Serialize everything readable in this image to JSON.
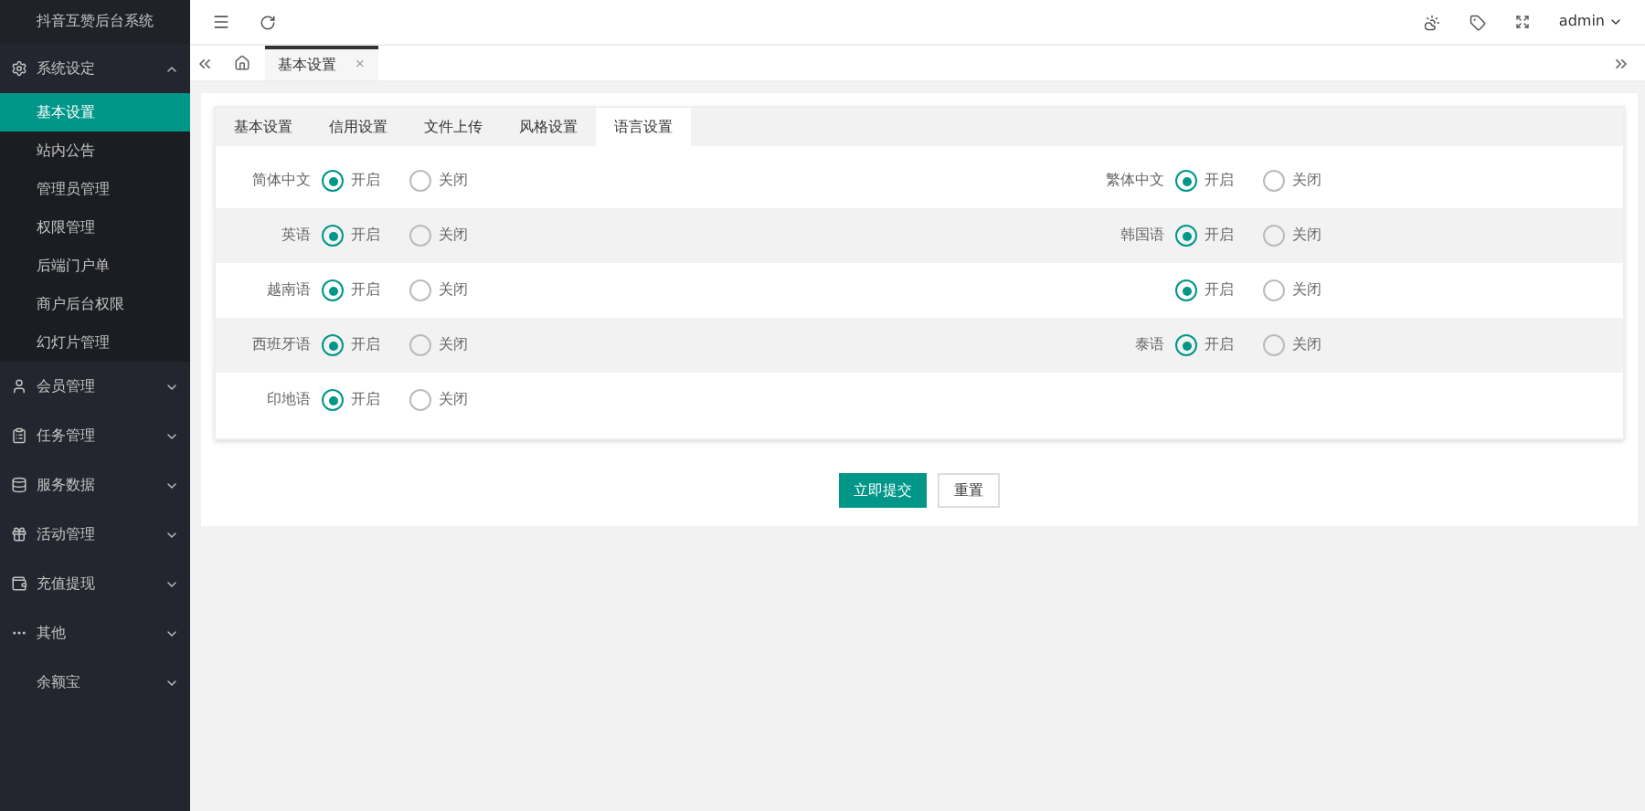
{
  "sidebar": {
    "title": "抖音互赞后台系统",
    "groups": [
      {
        "label": "系统设定",
        "expanded": true,
        "children": [
          {
            "label": "基本设置",
            "selected": true
          },
          {
            "label": "站内公告",
            "selected": false
          },
          {
            "label": "管理员管理",
            "selected": false
          },
          {
            "label": "权限管理",
            "selected": false
          },
          {
            "label": "后端门户单",
            "selected": false
          },
          {
            "label": "商户后台权限",
            "selected": false
          },
          {
            "label": "幻灯片管理",
            "selected": false
          }
        ]
      },
      {
        "label": "会员管理",
        "expanded": false
      },
      {
        "label": "任务管理",
        "expanded": false
      },
      {
        "label": "服务数据",
        "expanded": false
      },
      {
        "label": "活动管理",
        "expanded": false
      },
      {
        "label": "充值提现",
        "expanded": false
      },
      {
        "label": "其他",
        "expanded": false
      },
      {
        "label": "余额宝",
        "expanded": false
      }
    ]
  },
  "topbar": {
    "user": "admin"
  },
  "page_tabs": [
    {
      "label": "基本设置",
      "selected": true,
      "close": "×"
    }
  ],
  "settings_tabs": [
    {
      "label": "基本设置",
      "selected": false
    },
    {
      "label": "信用设置",
      "selected": false
    },
    {
      "label": "文件上传",
      "selected": false
    },
    {
      "label": "风格设置",
      "selected": false
    },
    {
      "label": "语言设置",
      "selected": true
    }
  ],
  "rows": [
    [
      {
        "label": "简体中文",
        "options": [
          {
            "label": "开启",
            "selected": true
          },
          {
            "label": "关闭",
            "selected": false
          }
        ]
      },
      {
        "label": "繁体中文",
        "options": [
          {
            "label": "开启",
            "selected": true
          },
          {
            "label": "关闭",
            "selected": false
          }
        ]
      }
    ],
    [
      {
        "label": "英语",
        "options": [
          {
            "label": "开启",
            "selected": true
          },
          {
            "label": "关闭",
            "selected": false
          }
        ]
      },
      {
        "label": "韩国语",
        "options": [
          {
            "label": "开启",
            "selected": true
          },
          {
            "label": "关闭",
            "selected": false
          }
        ]
      }
    ],
    [
      {
        "label": "越南语",
        "options": [
          {
            "label": "开启",
            "selected": true
          },
          {
            "label": "关闭",
            "selected": false
          }
        ]
      },
      {
        "options": [
          {
            "label": "开启",
            "selected": true
          },
          {
            "label": "关闭",
            "selected": false
          }
        ]
      }
    ],
    [
      {
        "label": "西班牙语",
        "options": [
          {
            "label": "开启",
            "selected": true
          },
          {
            "label": "关闭",
            "selected": false
          }
        ]
      },
      {
        "label": "泰语",
        "options": [
          {
            "label": "开启",
            "selected": true
          },
          {
            "label": "关闭",
            "selected": false
          }
        ]
      }
    ],
    [
      {
        "label": "印地语",
        "options": [
          {
            "label": "开启",
            "selected": true
          },
          {
            "label": "关闭",
            "selected": false
          }
        ]
      }
    ]
  ],
  "buttons": {
    "submit": "立即提交",
    "reset": "重置"
  }
}
